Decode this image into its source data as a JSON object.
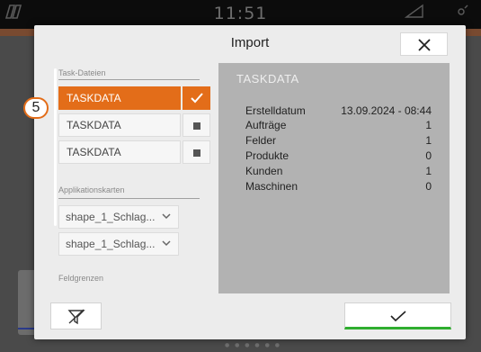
{
  "statusbar": {
    "clock": "11:51",
    "left_icon": "book-icon",
    "right_icons": [
      "signal-icon",
      "satellite-icon"
    ]
  },
  "dialog": {
    "title": "Import",
    "close_icon": "close-icon"
  },
  "task_files": {
    "section_label": "Task-Dateien",
    "items": [
      {
        "label": "TASKDATA",
        "selected": true
      },
      {
        "label": "TASKDATA",
        "selected": false
      },
      {
        "label": "TASKDATA",
        "selected": false
      }
    ]
  },
  "application_maps": {
    "section_label": "Applikationskarten",
    "items": [
      {
        "label": "shape_1_Schlag..."
      },
      {
        "label": "shape_1_Schlag..."
      }
    ]
  },
  "field_boundaries": {
    "section_label": "Feldgrenzen"
  },
  "marker": {
    "number": "5"
  },
  "details": {
    "title": "TASKDATA",
    "rows": [
      {
        "key": "Erstelldatum",
        "value": "13.09.2024 - 08:44"
      },
      {
        "key": "Aufträge",
        "value": "1"
      },
      {
        "key": "Felder",
        "value": "1"
      },
      {
        "key": "Produkte",
        "value": "0"
      },
      {
        "key": "Kunden",
        "value": "1"
      },
      {
        "key": "Maschinen",
        "value": "0"
      }
    ]
  },
  "buttons": {
    "filter_icon": "filter-off-icon",
    "confirm_icon": "checkmark-icon"
  },
  "colors": {
    "accent": "#e36d19",
    "confirm_accent": "#2fae2f",
    "panel": "#b2b2b2"
  }
}
